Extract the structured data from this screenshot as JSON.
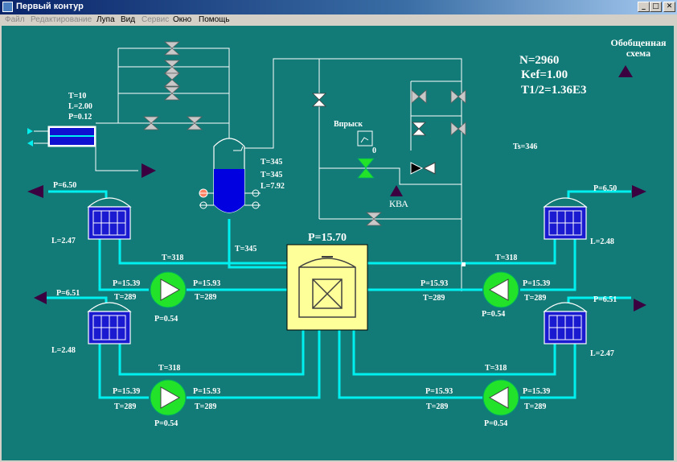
{
  "window": {
    "title": "Первый контур"
  },
  "window_controls": {
    "minimize": "_",
    "maximize": "□",
    "close": "✕"
  },
  "menu": [
    {
      "label": "Файл",
      "enabled": false
    },
    {
      "label": "Редактирование",
      "enabled": false
    },
    {
      "label": "Лупа",
      "enabled": true
    },
    {
      "label": "Вид",
      "enabled": true
    },
    {
      "label": "Сервис",
      "enabled": false
    },
    {
      "label": "Окно",
      "enabled": true
    },
    {
      "label": "Помощь",
      "enabled": true
    }
  ],
  "reactor": {
    "n": "N=2960",
    "kef": "Kef=1.00",
    "t_half": "T1/2=1.36E3",
    "ts": "Ts=346",
    "p": "P=15.70"
  },
  "scheme_link": {
    "label": "Обобщенная схема"
  },
  "heat_exchanger": {
    "t": "T=10",
    "l": "L=2.00",
    "p": "P=0.12"
  },
  "pressurizer": {
    "t1": "T=345",
    "t2": "T=345",
    "l": "L=7.92",
    "pipe_t": "T=345"
  },
  "injection": {
    "label": "Впрыск",
    "gauge": "0",
    "kva": "КВА"
  },
  "loops": {
    "top_left": {
      "sg_p": "P=6.50",
      "sg_l": "L=2.47",
      "hot_t": "T=318",
      "pump_in_p": "P=15.39",
      "pump_out_p": "P=15.93",
      "pump_in_t": "T=289",
      "pump_out_t": "T=289",
      "pump_dp": "P=0.54"
    },
    "bottom_left": {
      "sg_p": "P=6.51",
      "sg_l": "L=2.48",
      "hot_t": "T=318",
      "pump_in_p": "P=15.39",
      "pump_out_p": "P=15.93",
      "pump_in_t": "T=289",
      "pump_out_t": "T=289",
      "pump_dp": "P=0.54"
    },
    "top_right": {
      "sg_p": "P=6.50",
      "sg_l": "L=2.48",
      "hot_t": "T=318",
      "pump_in_p": "P=15.39",
      "pump_out_p": "P=15.93",
      "pump_in_t": "T=289",
      "pump_out_t": "T=289",
      "pump_dp": "P=0.54"
    },
    "bottom_right": {
      "sg_p": "P=6.51",
      "sg_l": "L=2.47",
      "hot_t": "T=318",
      "pump_in_p": "P=15.39",
      "pump_out_p": "P=15.93",
      "pump_in_t": "T=289",
      "pump_out_t": "T=289",
      "pump_dp": "P=0.54"
    }
  },
  "colors": {
    "background": "#137b77",
    "pipe": "#00f0f0",
    "line": "#ffffff",
    "pump": "#22e22a",
    "reactor": "#ffff99",
    "vessel": "#0000e0",
    "arrow": "#3a0040"
  }
}
